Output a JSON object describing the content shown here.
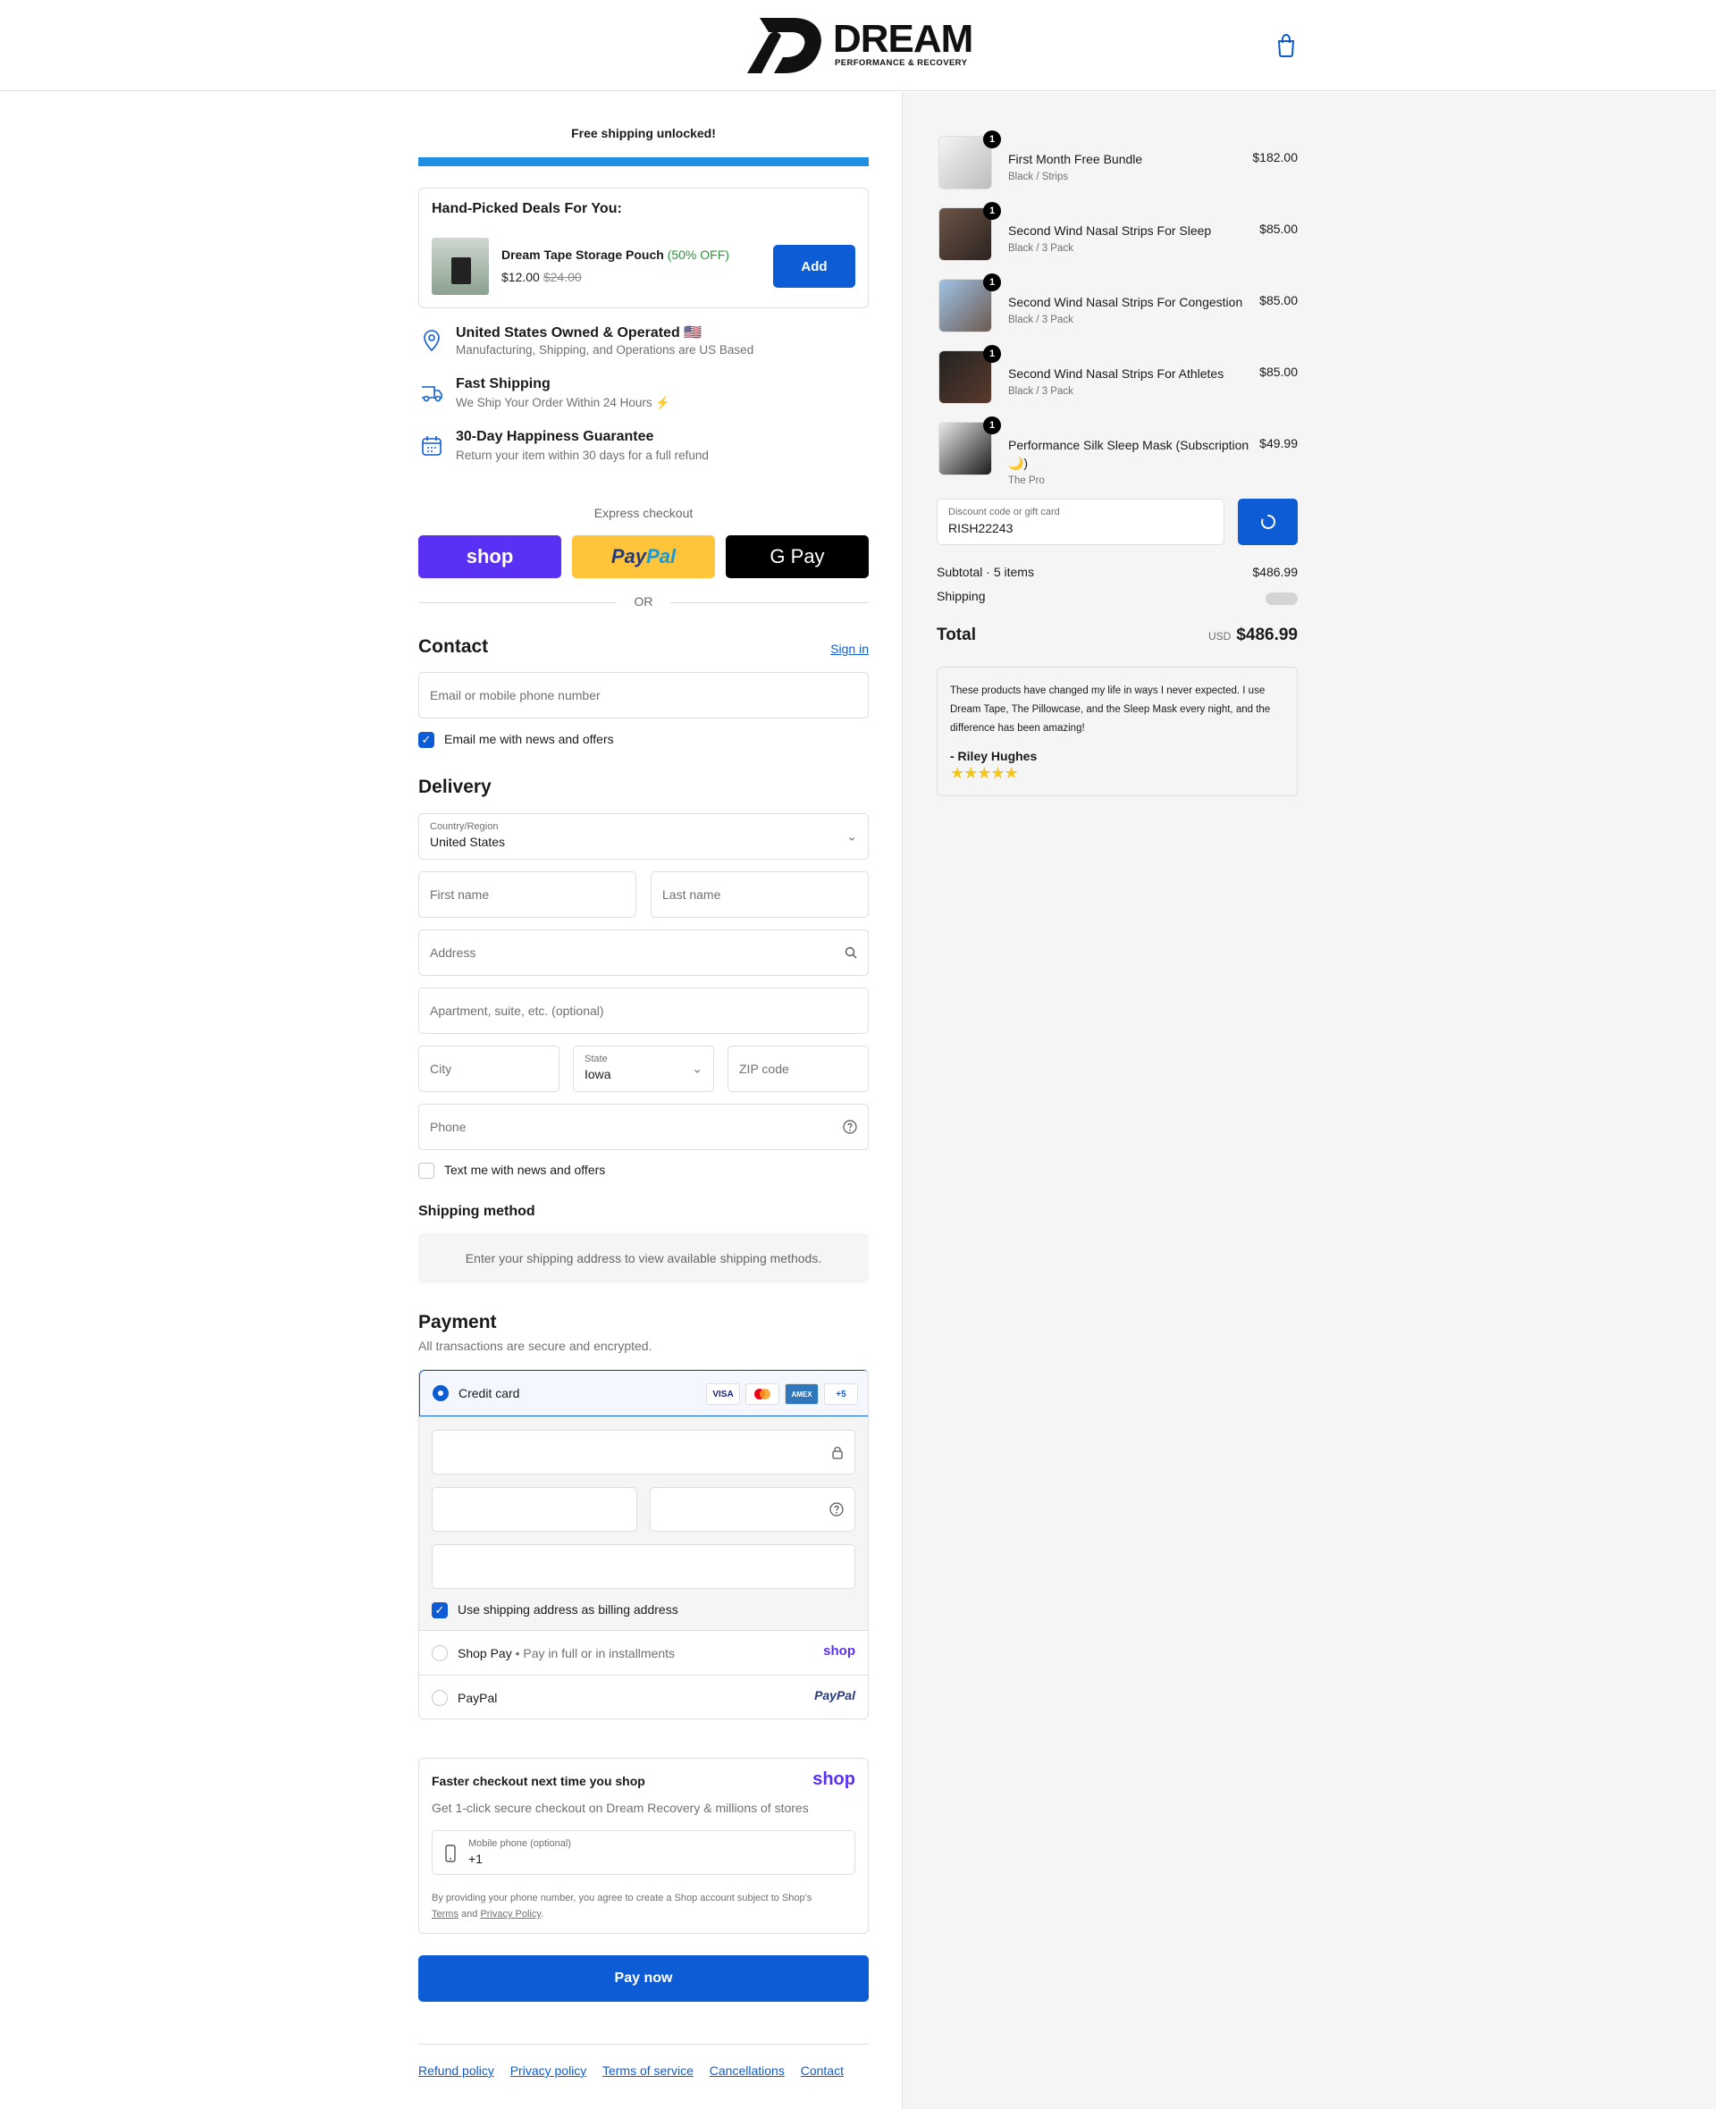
{
  "header": {
    "logo_word": "DREAM",
    "logo_sub": "PERFORMANCE & RECOVERY",
    "cart_icon": "shopping-bag-icon"
  },
  "promo": {
    "free_shipping": "Free shipping unlocked!",
    "progress_fraction": 1.0,
    "progress_color": "#1e8fe1"
  },
  "deals": {
    "title": "Hand-Picked Deals For You:",
    "item_name": "Dream Tape Storage Pouch",
    "item_discount": "(50% OFF)",
    "price": "$12.00",
    "old_price": "$24.00",
    "add_label": "Add"
  },
  "features": [
    {
      "icon": "location-pin-icon",
      "title": "United States Owned & Operated 🇺🇸",
      "sub": "Manufacturing, Shipping, and Operations are US Based"
    },
    {
      "icon": "delivery-truck-icon",
      "title": "Fast Shipping",
      "sub": "We Ship Your Order Within 24 Hours ⚡"
    },
    {
      "icon": "calendar-icon",
      "title": "30-Day Happiness Guarantee",
      "sub": "Return your item within 30 days for a full refund"
    }
  ],
  "express": {
    "label": "Express checkout",
    "shop": "shop",
    "paypal_a": "Pay",
    "paypal_b": "Pal",
    "gpay": "G Pay",
    "or": "OR"
  },
  "contact": {
    "title": "Contact",
    "signin": "Sign in",
    "email_placeholder": "Email or mobile phone number",
    "news_label": "Email me with news and offers",
    "news_checked": true
  },
  "delivery": {
    "title": "Delivery",
    "country_label": "Country/Region",
    "country_value": "United States",
    "first_name": "First name",
    "last_name": "Last name",
    "address": "Address",
    "apartment": "Apartment, suite, etc. (optional)",
    "city": "City",
    "state_label": "State",
    "state_value": "Iowa",
    "zip": "ZIP code",
    "phone": "Phone",
    "text_label": "Text me with news and offers",
    "text_checked": false
  },
  "shipping_method": {
    "title": "Shipping method",
    "note": "Enter your shipping address to view available shipping methods."
  },
  "payment": {
    "title": "Payment",
    "sub": "All transactions are secure and encrypted.",
    "credit_card": "Credit card",
    "badges": [
      "VISA",
      "MC",
      "AMEX",
      "+5"
    ],
    "billing_label": "Use shipping address as billing address",
    "billing_checked": true,
    "shop_pay": "Shop Pay",
    "shop_pay_sub": "Pay in full or in installments",
    "shop_logo": "shop",
    "paypal": "PayPal",
    "paypal_logo": "PayPal"
  },
  "fast_checkout": {
    "title": "Faster checkout next time you shop",
    "logo": "shop",
    "sub": "Get 1-click secure checkout on Dream Recovery & millions of stores",
    "phone_label": "Mobile phone (optional)",
    "phone_value": "+1",
    "note_pre": "By providing your phone number, you agree to create a Shop account subject to Shop's",
    "terms": "Terms",
    "and": "and",
    "privacy": "Privacy Policy",
    "period": "."
  },
  "pay_now": "Pay now",
  "footer": [
    "Refund policy",
    "Privacy policy",
    "Terms of service",
    "Cancellations",
    "Contact"
  ],
  "order": {
    "items": [
      {
        "qty": "1",
        "name": "First Month Free Bundle",
        "variant": "Black / Strips",
        "price": "$182.00"
      },
      {
        "qty": "1",
        "name": "Second Wind Nasal Strips For Sleep",
        "variant": "Black / 3 Pack",
        "price": "$85.00"
      },
      {
        "qty": "1",
        "name": "Second Wind Nasal Strips For Congestion",
        "variant": "Black / 3 Pack",
        "price": "$85.00"
      },
      {
        "qty": "1",
        "name": "Second Wind Nasal Strips For Athletes",
        "variant": "Black / 3 Pack",
        "price": "$85.00"
      },
      {
        "qty": "1",
        "name": "Performance Silk Sleep Mask (Subscription 🌙)",
        "variant": "The Pro",
        "price": "$49.99"
      }
    ],
    "discount_label": "Discount code or gift card",
    "discount_value": "RISH22243",
    "subtotal_label": "Subtotal · 5 items",
    "subtotal_value": "$486.99",
    "shipping_label": "Shipping",
    "total_label": "Total",
    "currency": "USD",
    "total_value": "$486.99"
  },
  "review": {
    "text": "These products have changed my life in ways I never expected. I use Dream Tape, The Pillowcase, and the Sleep Mask every night, and the difference has been amazing!",
    "author": "- Riley Hughes",
    "stars": "★★★★★"
  }
}
